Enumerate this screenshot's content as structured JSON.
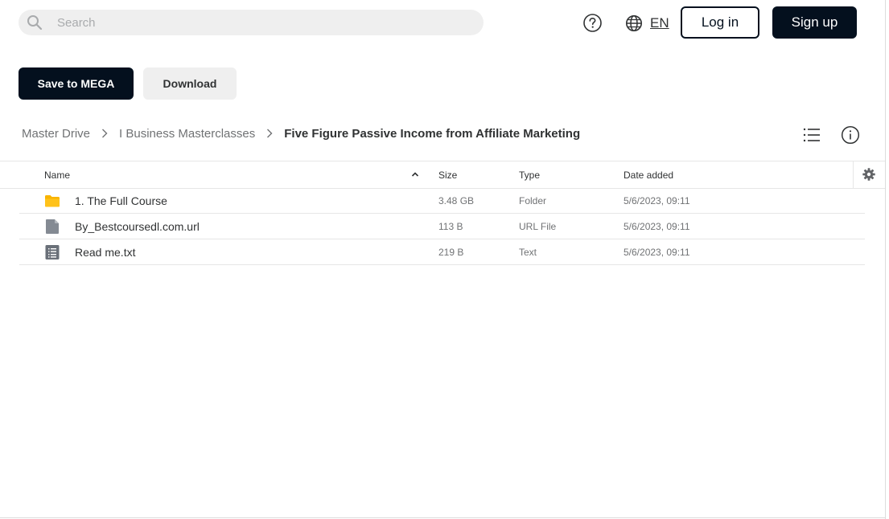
{
  "header": {
    "search_placeholder": "Search",
    "search_value": "",
    "language": "EN",
    "login_label": "Log in",
    "signup_label": "Sign up"
  },
  "actions": {
    "save_label": "Save to MEGA",
    "download_label": "Download"
  },
  "breadcrumb": [
    {
      "label": "Master Drive"
    },
    {
      "label": "I Business Masterclasses"
    },
    {
      "label": "Five Figure Passive Income from Affiliate Marketing"
    }
  ],
  "table": {
    "columns": {
      "name": "Name",
      "size": "Size",
      "type": "Type",
      "date": "Date added"
    },
    "sort": {
      "column": "name",
      "direction": "ascending"
    },
    "rows": [
      {
        "name": "1. The Full Course",
        "size": "3.48 GB",
        "type": "Folder",
        "date": "5/6/2023, 09:11",
        "icon": "folder-icon"
      },
      {
        "name": "By_Bestcoursedl.com.url",
        "size": "113 B",
        "type": "URL File",
        "date": "5/6/2023, 09:11",
        "icon": "generic-file-icon"
      },
      {
        "name": "Read me.txt",
        "size": "219 B",
        "type": "Text",
        "date": "5/6/2023, 09:11",
        "icon": "text-file-icon"
      }
    ]
  },
  "colors": {
    "primary_dark": "#04101e",
    "light_button": "#efefef",
    "folder_yellow": "#f9b400",
    "file_grey": "#848a93",
    "divider": "#e6e6e6"
  }
}
